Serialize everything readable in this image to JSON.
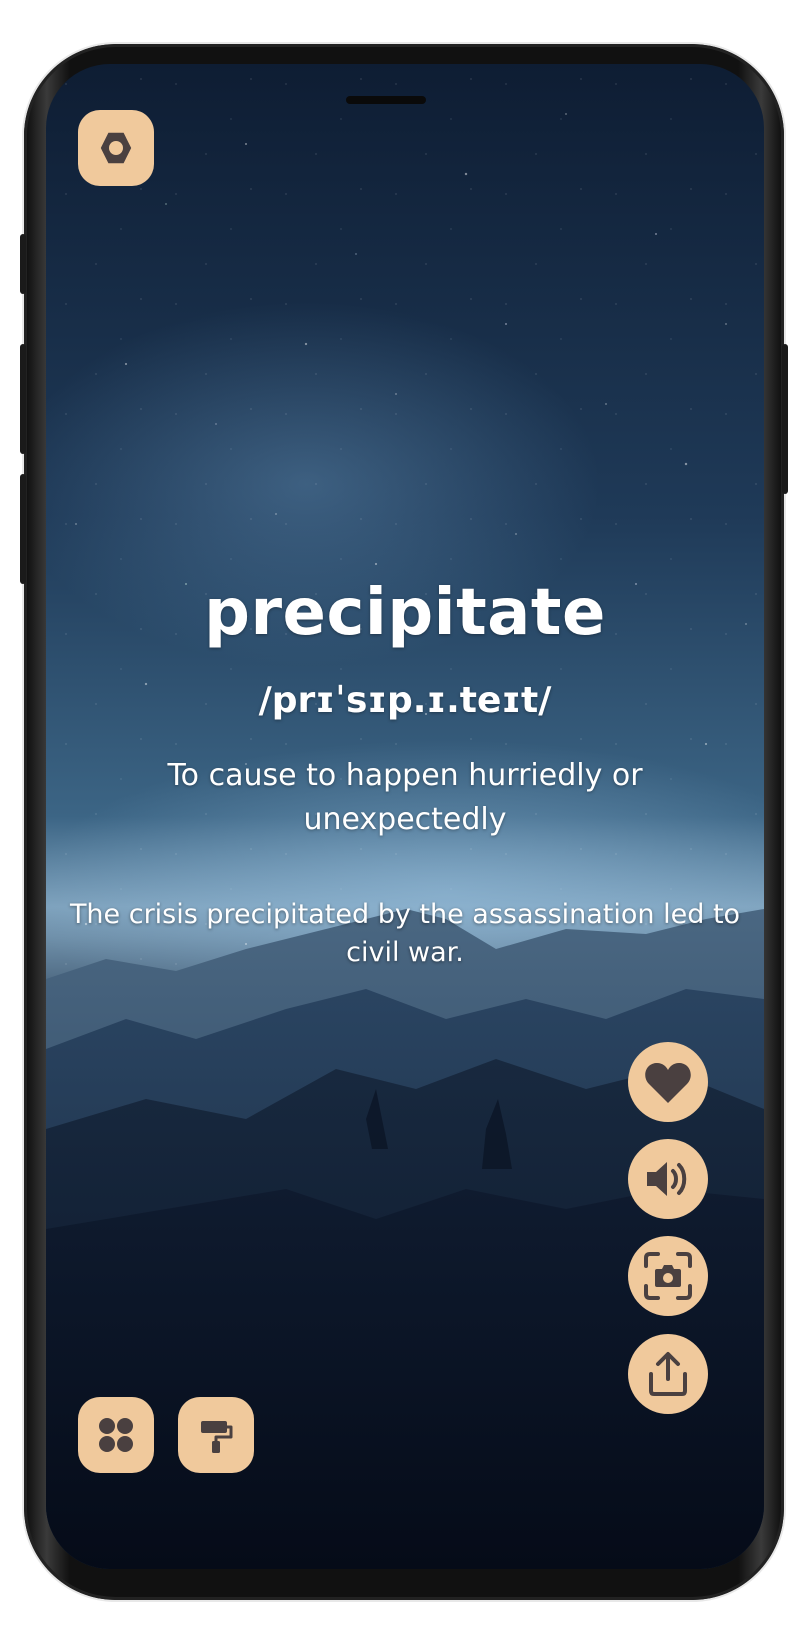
{
  "word": {
    "text": "precipitate",
    "phonetic": "/prɪˈsɪp.ɪ.teɪt/",
    "definition": "To cause to happen hurriedly or unexpectedly",
    "example": "The crisis precipitated by the assassination led to civil war."
  },
  "buttons": {
    "settings": {
      "icon": "settings-hex-icon"
    },
    "favorite": {
      "icon": "heart-icon"
    },
    "speak": {
      "icon": "speaker-icon"
    },
    "screenshot": {
      "icon": "camera-icon"
    },
    "share": {
      "icon": "share-icon"
    },
    "categories": {
      "icon": "grid-icon"
    },
    "themes": {
      "icon": "paint-roller-icon"
    }
  },
  "colors": {
    "button_bg": "#f0c99c",
    "icon": "#4a4040",
    "text": "#ffffff"
  }
}
